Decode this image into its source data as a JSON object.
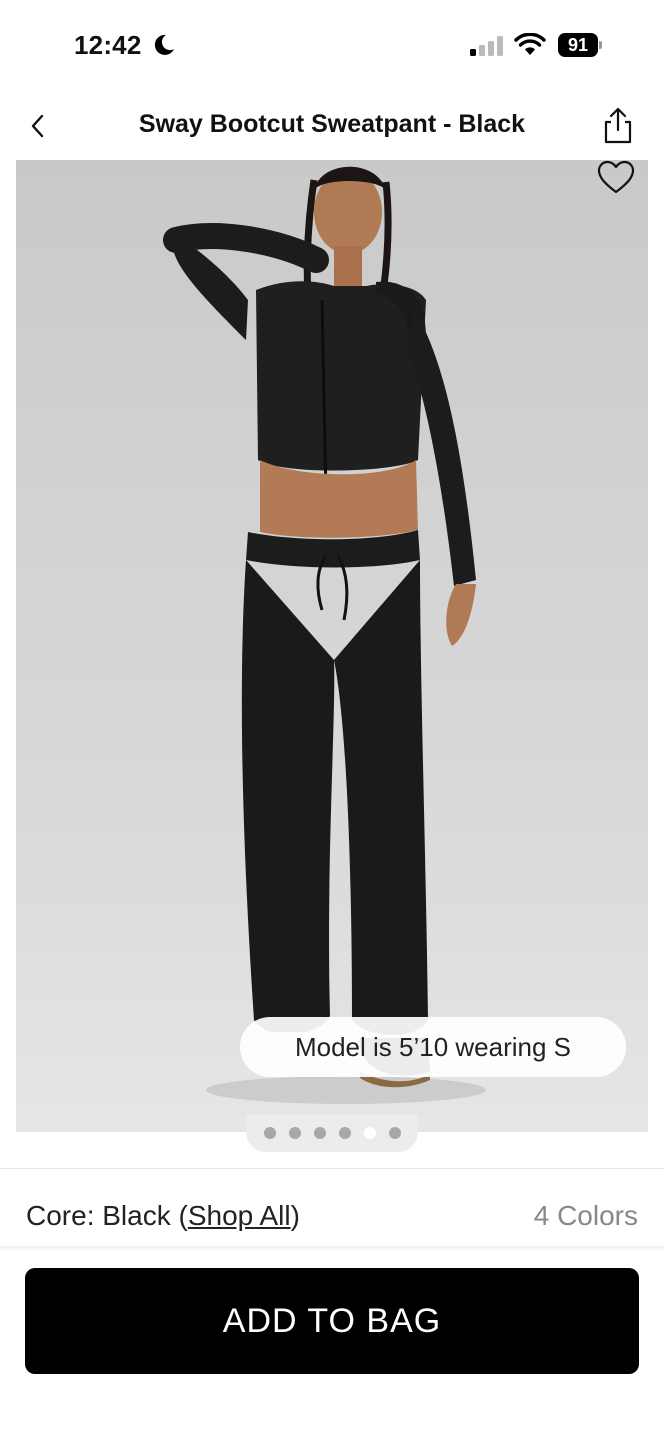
{
  "status_bar": {
    "time": "12:42",
    "battery": "91"
  },
  "nav": {
    "title": "Sway Bootcut Sweatpant - Black"
  },
  "product": {
    "model_info": "Model is 5’10 wearing S",
    "image_count": 6,
    "active_image_index": 4
  },
  "color": {
    "prefix": "Core: Black (",
    "shop_all": "Shop All",
    "suffix": ")",
    "count": "4 Colors"
  },
  "cta": {
    "label": "ADD TO BAG"
  },
  "colors": {
    "cta_background": "#000000",
    "muted_text": "#888888"
  }
}
